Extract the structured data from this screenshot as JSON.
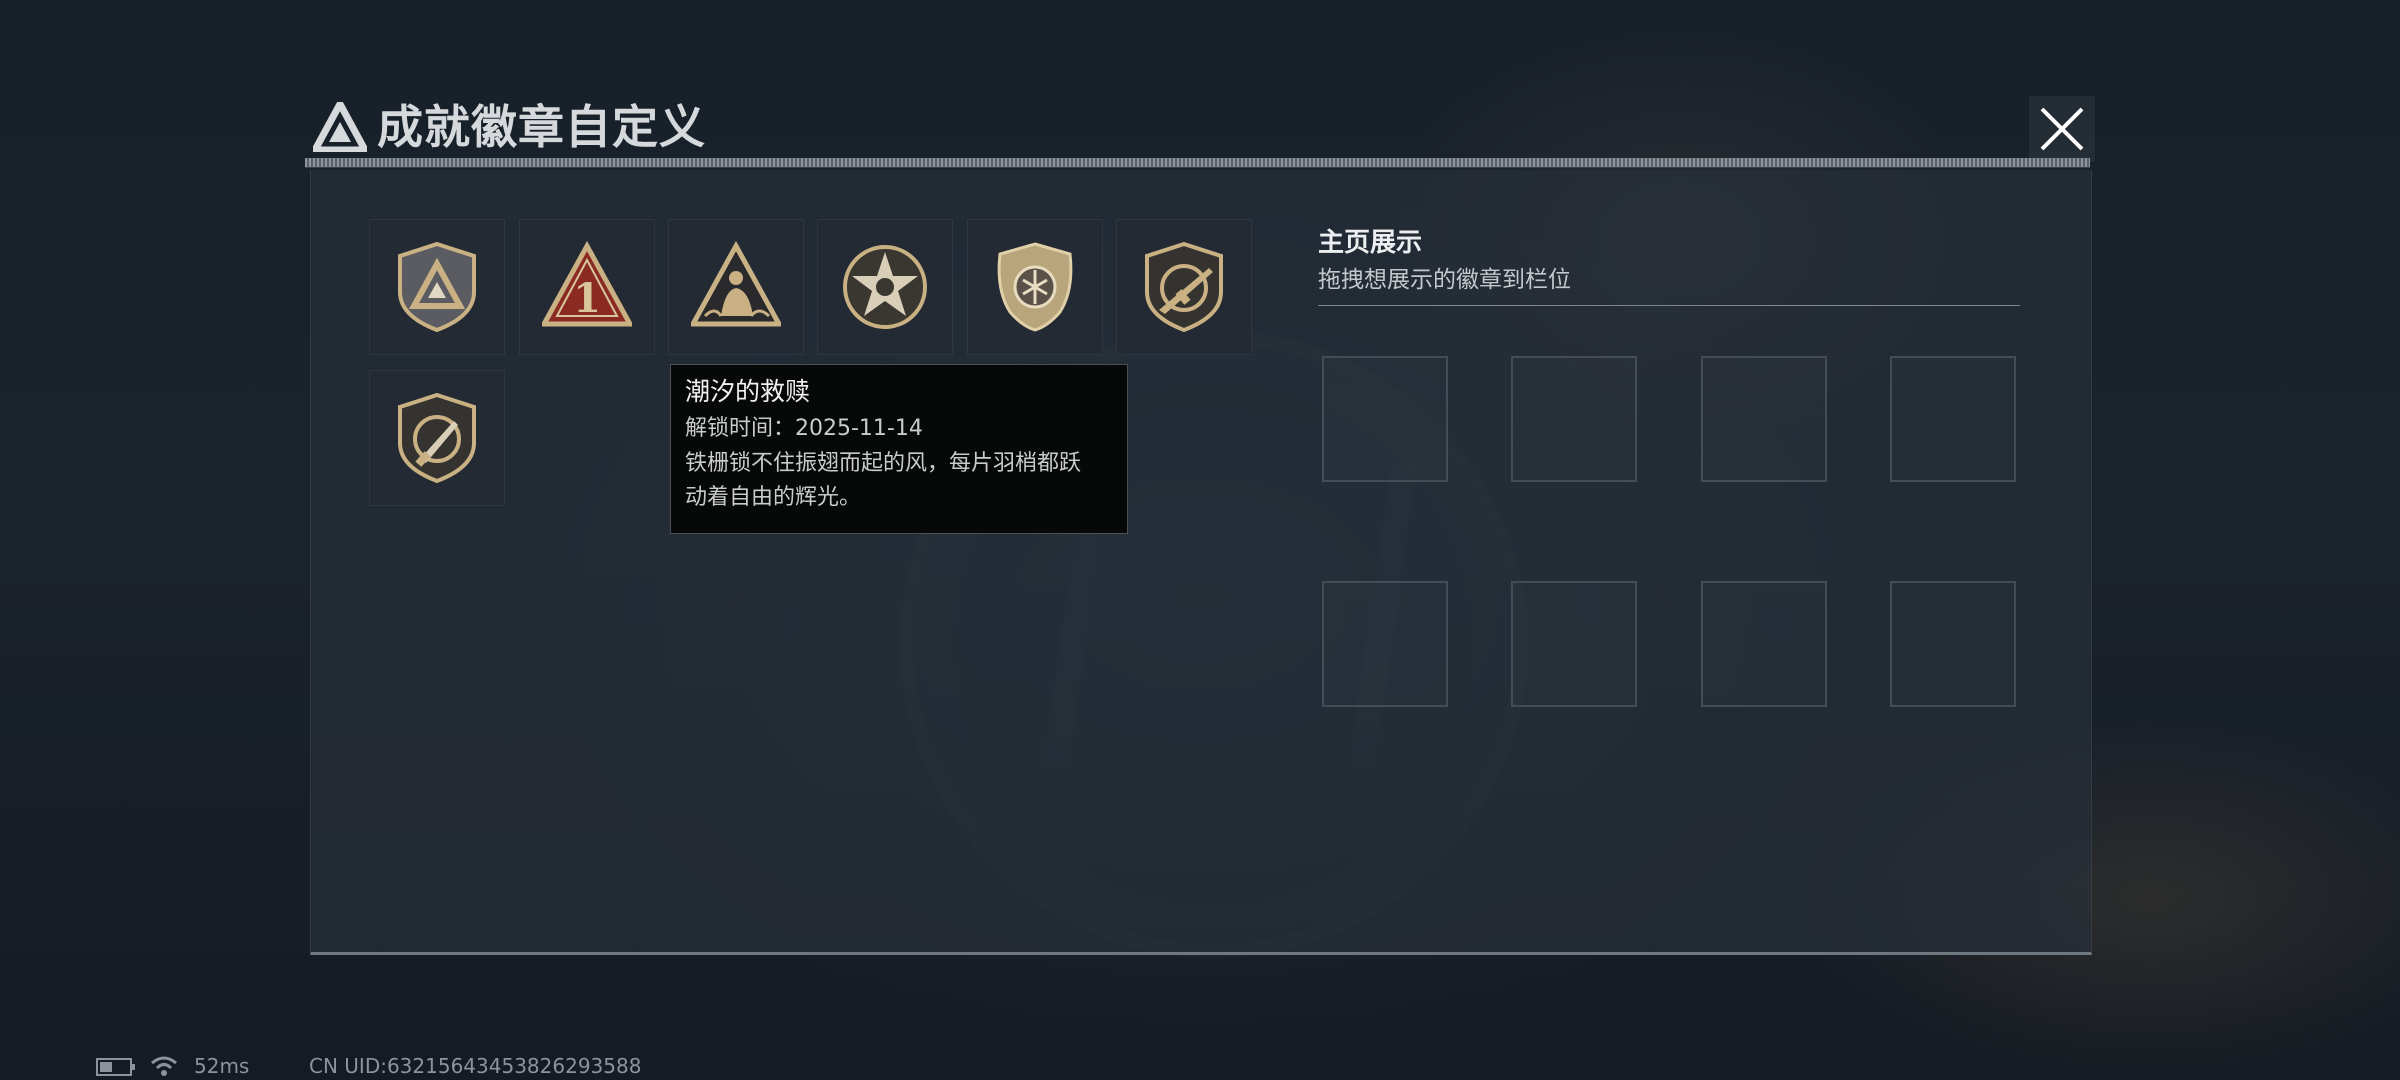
{
  "header": {
    "title": "成就徽章自定义",
    "logo_icon": "triangle-logo-icon",
    "close_icon": "close-icon"
  },
  "badges": [
    {
      "icon": "shield-triangle-badge-icon"
    },
    {
      "icon": "red-triangle-number-one-badge-icon"
    },
    {
      "icon": "triangle-figure-badge-icon"
    },
    {
      "icon": "star-skull-badge-icon"
    },
    {
      "icon": "shield-wing-badge-icon"
    },
    {
      "icon": "rifle-shield-badge-icon"
    },
    {
      "icon": "knife-shield-badge-icon"
    }
  ],
  "tooltip": {
    "name": "潮汐的救赎",
    "unlock_time": "解锁时间：2025-11-14",
    "description_line1": "铁栅锁不住振翅而起的风，每片羽梢都跃",
    "description_line2": "动着自由的辉光。"
  },
  "showcase": {
    "title": "主页展示",
    "subtitle": "拖拽想展示的徽章到栏位",
    "slot_count": 8
  },
  "footer": {
    "ping": "52ms",
    "uid": "CN UID:63215643453826293588",
    "battery_icon": "battery-icon",
    "wifi_icon": "wifi-icon"
  },
  "colors": {
    "background": "#161d25",
    "panel": "#28303a",
    "badge_gold": "#c9b183",
    "badge_red": "#8a2a22",
    "tooltip_bg": "#070808"
  }
}
